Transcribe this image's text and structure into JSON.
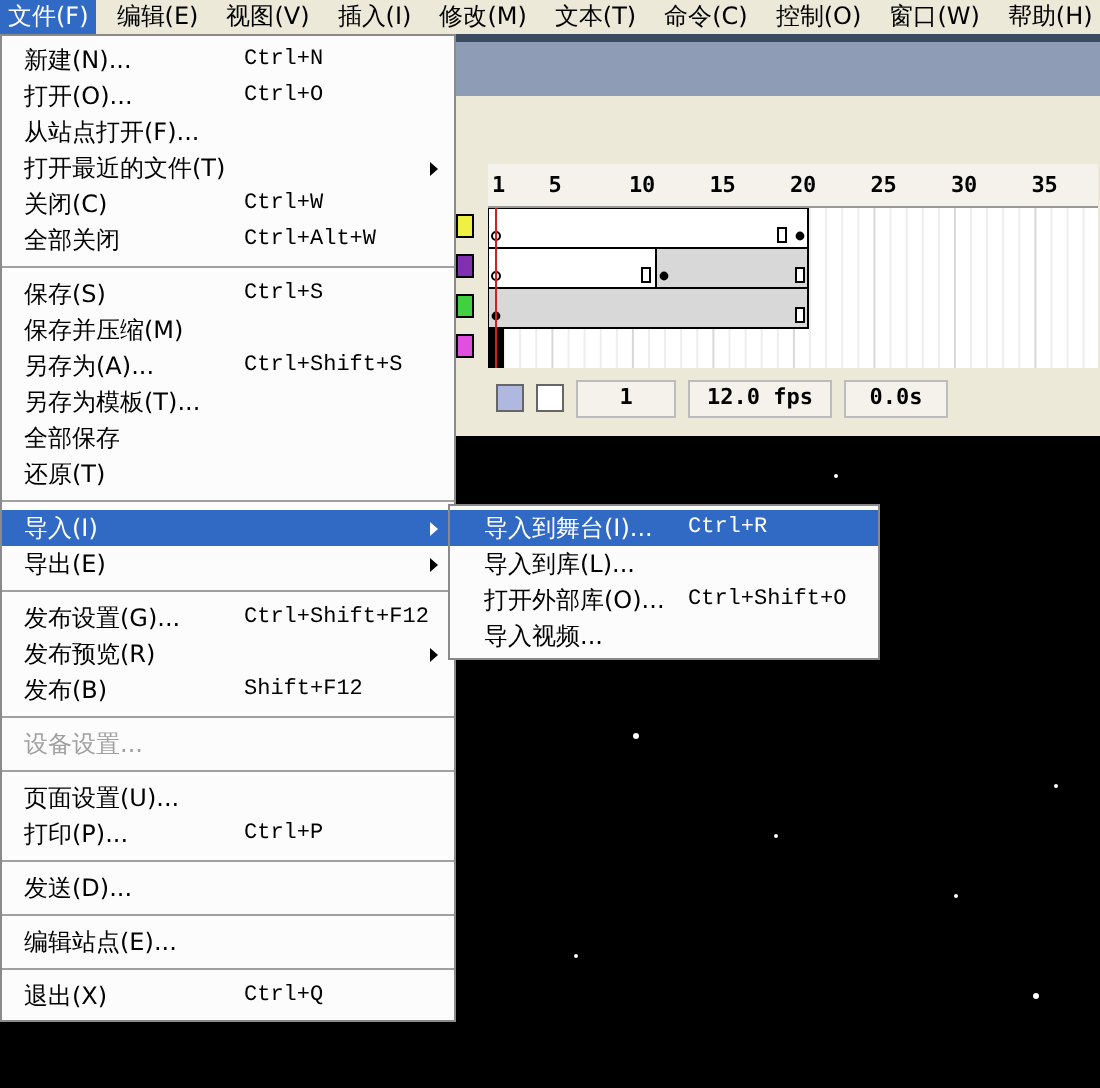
{
  "menubar": [
    {
      "label": "文件(F)",
      "selected": true
    },
    {
      "label": "编辑(E)",
      "selected": false
    },
    {
      "label": "视图(V)",
      "selected": false
    },
    {
      "label": "插入(I)",
      "selected": false
    },
    {
      "label": "修改(M)",
      "selected": false
    },
    {
      "label": "文本(T)",
      "selected": false
    },
    {
      "label": "命令(C)",
      "selected": false
    },
    {
      "label": "控制(O)",
      "selected": false
    },
    {
      "label": "窗口(W)",
      "selected": false
    },
    {
      "label": "帮助(H)",
      "selected": false
    }
  ],
  "file_menu": [
    [
      {
        "label": "新建(N)...",
        "shortcut": "Ctrl+N",
        "submenu": false,
        "disabled": false,
        "selected": false
      },
      {
        "label": "打开(O)...",
        "shortcut": "Ctrl+O",
        "submenu": false,
        "disabled": false,
        "selected": false
      },
      {
        "label": "从站点打开(F)...",
        "submenu": false,
        "disabled": false,
        "selected": false
      },
      {
        "label": "打开最近的文件(T)",
        "submenu": true,
        "disabled": false,
        "selected": false
      },
      {
        "label": "关闭(C)",
        "shortcut": "Ctrl+W",
        "submenu": false,
        "disabled": false,
        "selected": false
      },
      {
        "label": "全部关闭",
        "shortcut": "Ctrl+Alt+W",
        "submenu": false,
        "disabled": false,
        "selected": false
      }
    ],
    [
      {
        "label": "保存(S)",
        "shortcut": "Ctrl+S",
        "submenu": false,
        "disabled": false,
        "selected": false
      },
      {
        "label": "保存并压缩(M)",
        "submenu": false,
        "disabled": false,
        "selected": false
      },
      {
        "label": "另存为(A)...",
        "shortcut": "Ctrl+Shift+S",
        "submenu": false,
        "disabled": false,
        "selected": false
      },
      {
        "label": "另存为模板(T)...",
        "submenu": false,
        "disabled": false,
        "selected": false
      },
      {
        "label": "全部保存",
        "submenu": false,
        "disabled": false,
        "selected": false
      },
      {
        "label": "还原(T)",
        "submenu": false,
        "disabled": false,
        "selected": false
      }
    ],
    [
      {
        "label": "导入(I)",
        "submenu": true,
        "disabled": false,
        "selected": true
      },
      {
        "label": "导出(E)",
        "submenu": true,
        "disabled": false,
        "selected": false
      }
    ],
    [
      {
        "label": "发布设置(G)...",
        "shortcut": "Ctrl+Shift+F12",
        "submenu": false,
        "disabled": false,
        "selected": false
      },
      {
        "label": "发布预览(R)",
        "submenu": true,
        "disabled": false,
        "selected": false
      },
      {
        "label": "发布(B)",
        "shortcut": "Shift+F12",
        "submenu": false,
        "disabled": false,
        "selected": false
      }
    ],
    [
      {
        "label": "设备设置...",
        "submenu": false,
        "disabled": true,
        "selected": false
      }
    ],
    [
      {
        "label": "页面设置(U)...",
        "submenu": false,
        "disabled": false,
        "selected": false
      },
      {
        "label": "打印(P)...",
        "shortcut": "Ctrl+P",
        "submenu": false,
        "disabled": false,
        "selected": false
      }
    ],
    [
      {
        "label": "发送(D)...",
        "submenu": false,
        "disabled": false,
        "selected": false
      }
    ],
    [
      {
        "label": "编辑站点(E)...",
        "submenu": false,
        "disabled": false,
        "selected": false
      }
    ],
    [
      {
        "label": "退出(X)",
        "shortcut": "Ctrl+Q",
        "submenu": false,
        "disabled": false,
        "selected": false
      }
    ]
  ],
  "import_submenu": [
    {
      "label": "导入到舞台(I)...",
      "shortcut": "Ctrl+R",
      "selected": true
    },
    {
      "label": "导入到库(L)...",
      "selected": false
    },
    {
      "label": "打开外部库(O)...",
      "shortcut": "Ctrl+Shift+O",
      "selected": false
    },
    {
      "label": "导入视频...",
      "selected": false
    }
  ],
  "timeline": {
    "frame_numbers": [
      "1",
      "5",
      "10",
      "15",
      "20",
      "25",
      "30",
      "35"
    ],
    "layers": [
      {
        "color": "#f0f040"
      },
      {
        "color": "#8030b0"
      },
      {
        "color": "#40d040"
      },
      {
        "color": "#e050e0"
      }
    ],
    "current_frame": "1",
    "frame_rate": "12.0 fps",
    "elapsed": "0.0s"
  }
}
